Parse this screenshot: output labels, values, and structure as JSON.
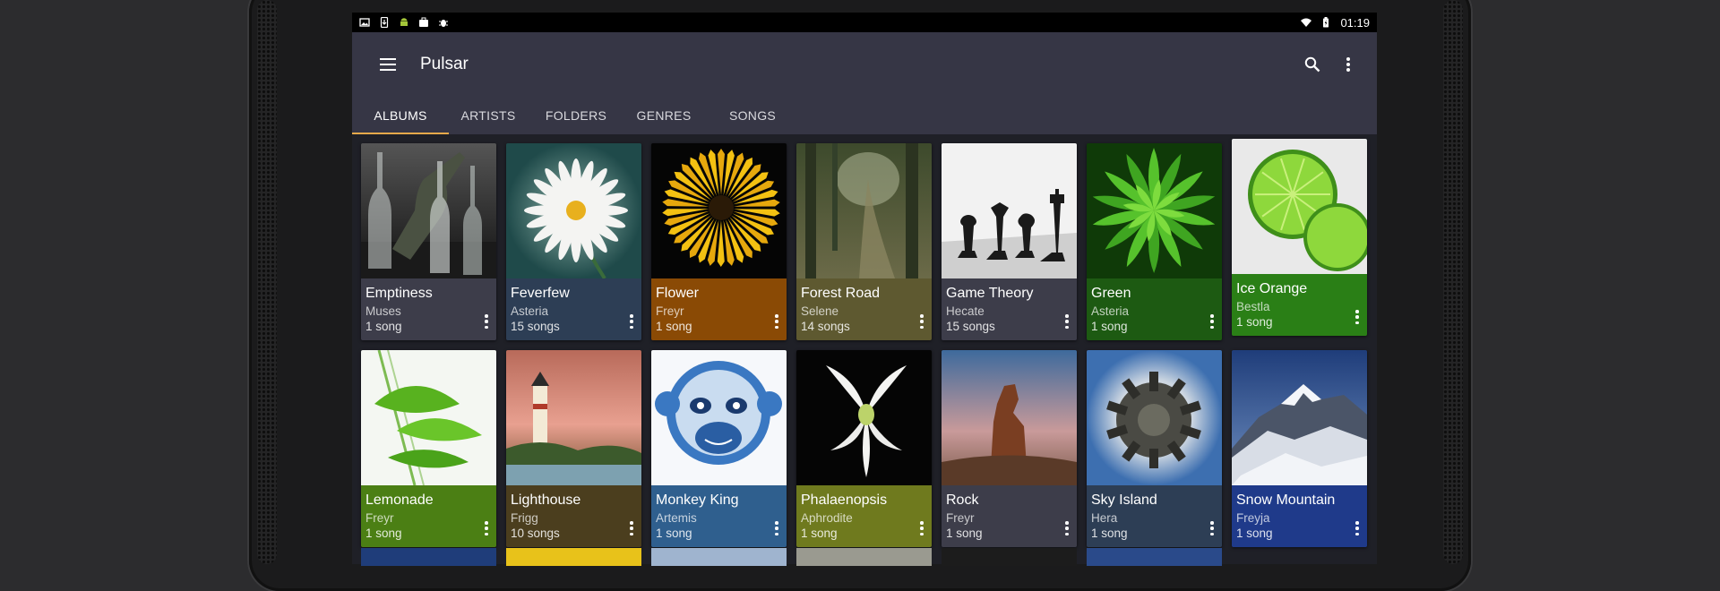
{
  "status_bar": {
    "time": "01:19",
    "left_icons": [
      "image-icon",
      "download-icon",
      "android-icon",
      "briefcase-icon",
      "bug-icon"
    ],
    "right_icons": [
      "wifi-icon",
      "battery-icon"
    ]
  },
  "app_bar": {
    "title": "Pulsar",
    "menu_icon": "hamburger-menu-icon",
    "actions": [
      "search-icon",
      "overflow-menu-icon"
    ]
  },
  "tabs": [
    {
      "label": "ALBUMS",
      "active": true
    },
    {
      "label": "ARTISTS",
      "active": false
    },
    {
      "label": "FOLDERS",
      "active": false
    },
    {
      "label": "GENRES",
      "active": false
    },
    {
      "label": "SONGS",
      "active": false
    }
  ],
  "accent_color": "#e6a94a",
  "albums": [
    {
      "title": "Emptiness",
      "artist": "Muses",
      "count": "1 song",
      "color": "#3d3d4a",
      "art": "bottles"
    },
    {
      "title": "Feverfew",
      "artist": "Asteria",
      "count": "15 songs",
      "color": "#2d3e55",
      "art": "daisy"
    },
    {
      "title": "Flower",
      "artist": "Freyr",
      "count": "1 song",
      "color": "#8a4a05",
      "art": "sunflower"
    },
    {
      "title": "Forest Road",
      "artist": "Selene",
      "count": "14 songs",
      "color": "#5e5930",
      "art": "forest"
    },
    {
      "title": "Game Theory",
      "artist": "Hecate",
      "count": "15 songs",
      "color": "#3d3d4a",
      "art": "chess"
    },
    {
      "title": "Green",
      "artist": "Asteria",
      "count": "1 song",
      "color": "#1d5a12",
      "art": "succulent"
    },
    {
      "title": "Ice Orange",
      "artist": "Bestla",
      "count": "1 song",
      "color": "#2a7f16",
      "art": "lime-slices"
    },
    {
      "title": "Lemonade",
      "artist": "Freyr",
      "count": "1 song",
      "color": "#4b7f14",
      "art": "lime-glass"
    },
    {
      "title": "Lighthouse",
      "artist": "Frigg",
      "count": "10 songs",
      "color": "#4b3e1e",
      "art": "lighthouse"
    },
    {
      "title": "Monkey King",
      "artist": "Artemis",
      "count": "1 song",
      "color": "#2f5f8e",
      "art": "monkey"
    },
    {
      "title": "Phalaenopsis",
      "artist": "Aphrodite",
      "count": "1 song",
      "color": "#6f7a1e",
      "art": "orchid"
    },
    {
      "title": "Rock",
      "artist": "Freyr",
      "count": "1 song",
      "color": "#3d3d4a",
      "art": "rock"
    },
    {
      "title": "Sky Island",
      "artist": "Hera",
      "count": "1 song",
      "color": "#2d3e55",
      "art": "planet"
    },
    {
      "title": "Snow Mountain",
      "artist": "Freyja",
      "count": "1 song",
      "color": "#1f3a8a",
      "art": "mountain"
    }
  ]
}
